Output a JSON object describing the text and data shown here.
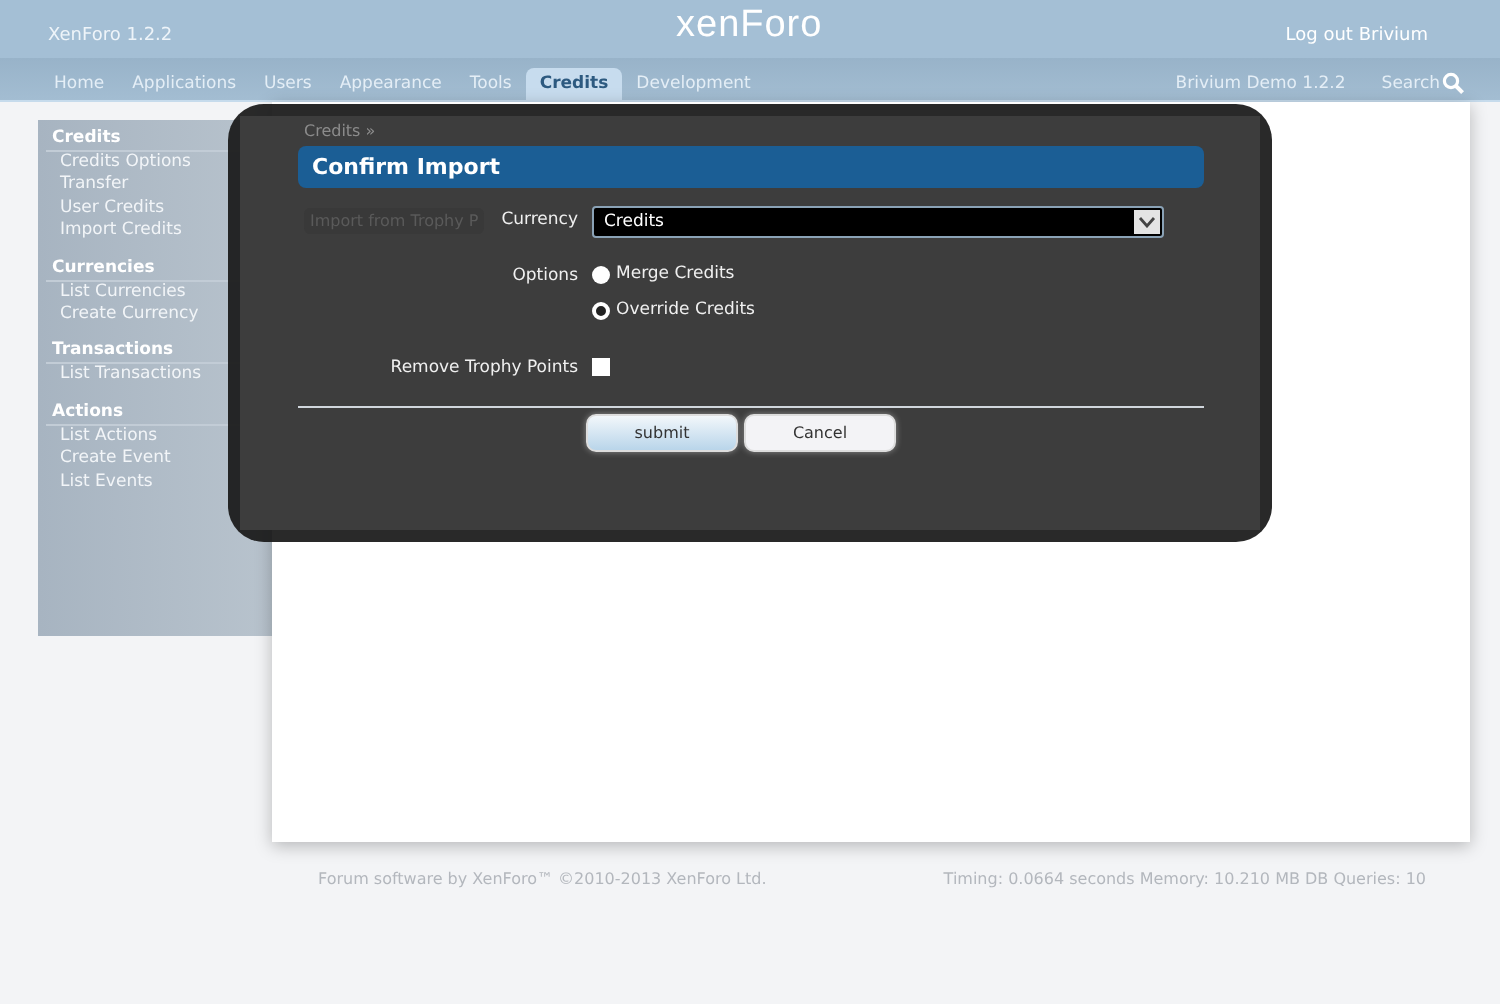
{
  "header": {
    "title": "XenForo 1.2.2",
    "logo": "xenForo",
    "logout": "Log out Brivium"
  },
  "nav": {
    "tabs": [
      {
        "label": "Home",
        "selected": false
      },
      {
        "label": "Applications",
        "selected": false
      },
      {
        "label": "Users",
        "selected": false
      },
      {
        "label": "Appearance",
        "selected": false
      },
      {
        "label": "Tools",
        "selected": false
      },
      {
        "label": "Credits",
        "selected": true
      },
      {
        "label": "Development",
        "selected": false
      }
    ],
    "site": "Brivium Demo 1.2.2",
    "search": "Search"
  },
  "sidebar": {
    "sections": [
      {
        "heading": "Credits",
        "items": [
          "Credits Options",
          "Transfer",
          "User Credits",
          "Import Credits"
        ]
      },
      {
        "heading": "Currencies",
        "items": [
          "List Currencies",
          "Create Currency"
        ]
      },
      {
        "heading": "Transactions",
        "items": [
          "List Transactions"
        ]
      },
      {
        "heading": "Actions",
        "items": [
          "List Actions",
          "Create Event",
          "List Events"
        ]
      }
    ]
  },
  "content": {
    "breadcrumb": "Credits »",
    "button": "Import from Trophy P"
  },
  "dialog": {
    "title": "Confirm Import",
    "fields": [
      {
        "kind": "select",
        "label": "Currency",
        "value": "Credits"
      },
      {
        "kind": "radio",
        "label": "Options",
        "options": [
          {
            "label": "Merge Credits",
            "selected": false
          },
          {
            "label": "Override Credits",
            "selected": true
          }
        ]
      },
      {
        "kind": "checkbox",
        "label": "Remove Trophy Points",
        "checked": false
      }
    ],
    "buttons": [
      {
        "label": "submit",
        "primary": true
      },
      {
        "label": "Cancel",
        "primary": false
      }
    ]
  },
  "footer": {
    "copyright": "Forum software by XenForo™ ©2010-2013 XenForo Ltd.",
    "stats": "Timing: 0.0664 seconds Memory: 10.210 MB DB Queries: 10"
  }
}
